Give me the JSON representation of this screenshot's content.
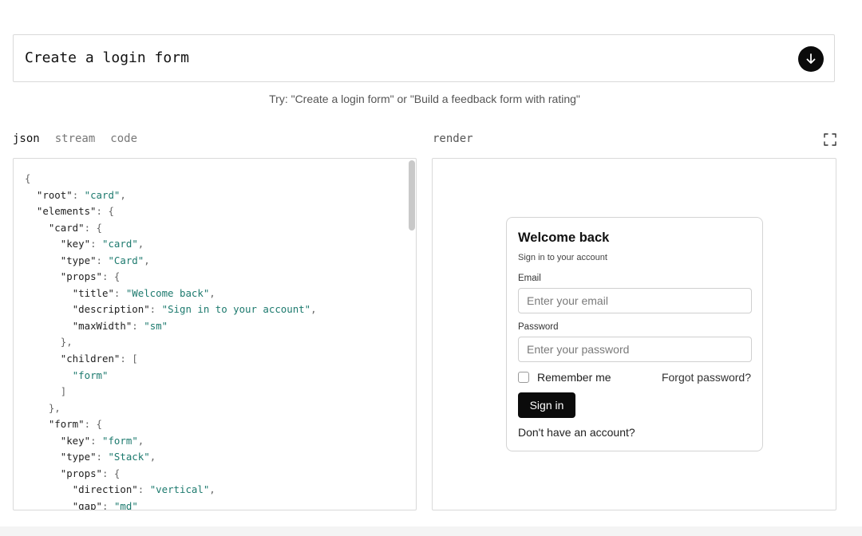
{
  "prompt": {
    "value": "Create a login form",
    "submit_icon": "arrow-down-icon"
  },
  "hint": "Try: \"Create a login form\" or \"Build a feedback form with rating\"",
  "tabs": [
    {
      "label": "json",
      "active": true
    },
    {
      "label": "stream",
      "active": false
    },
    {
      "label": "code",
      "active": false
    }
  ],
  "render_label": "render",
  "expand_icon": "fullscreen-icon",
  "json_code": "{\n  \"root\": \"card\",\n  \"elements\": {\n    \"card\": {\n      \"key\": \"card\",\n      \"type\": \"Card\",\n      \"props\": {\n        \"title\": \"Welcome back\",\n        \"description\": \"Sign in to your account\",\n        \"maxWidth\": \"sm\"\n      },\n      \"children\": [\n        \"form\"\n      ]\n    },\n    \"form\": {\n      \"key\": \"form\",\n      \"type\": \"Stack\",\n      \"props\": {\n        \"direction\": \"vertical\",\n        \"gap\": \"md\"",
  "preview": {
    "title": "Welcome back",
    "description": "Sign in to your account",
    "email_label": "Email",
    "email_placeholder": "Enter your email",
    "password_label": "Password",
    "password_placeholder": "Enter your password",
    "remember_label": "Remember me",
    "forgot_link": "Forgot password?",
    "submit_label": "Sign in",
    "signup_text": "Don't have an account?"
  },
  "colors": {
    "accent": "#0b0b0b",
    "string": "#1d7a6e",
    "border": "#d9d9d9"
  }
}
